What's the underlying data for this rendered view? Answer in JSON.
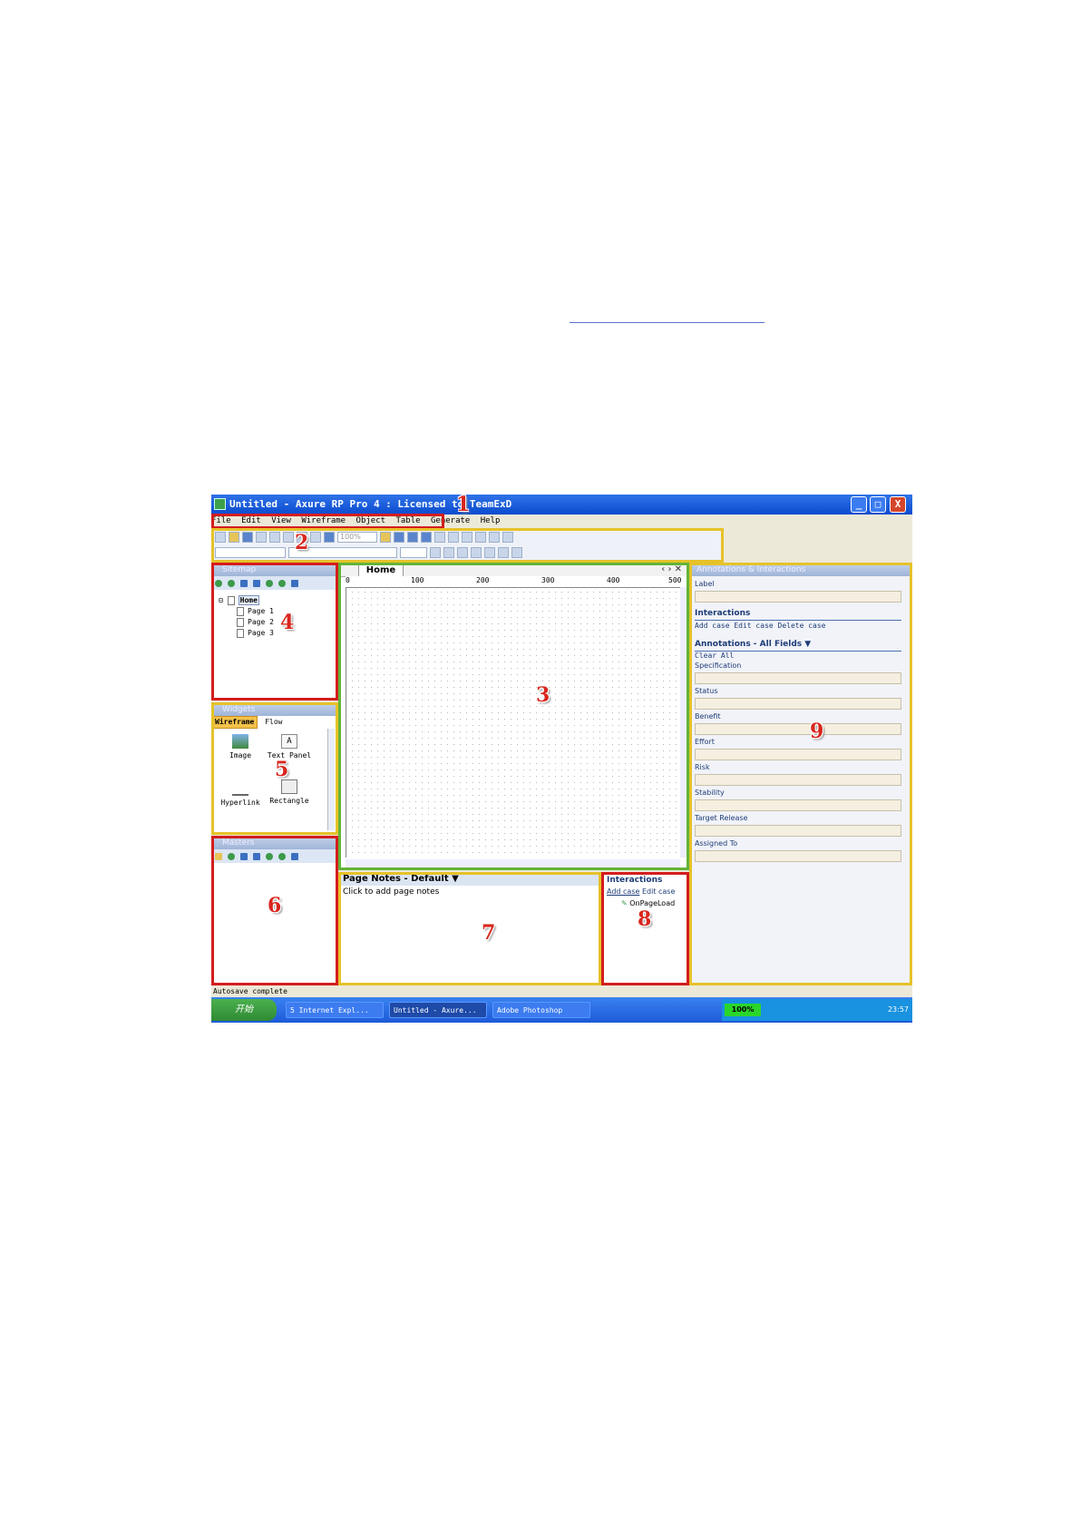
{
  "window": {
    "title": "Untitled - Axure RP Pro 4 : Licensed to TeamExD",
    "buttons": {
      "minimize": "_",
      "maximize": "□",
      "close": "X"
    }
  },
  "menu": [
    "File",
    "Edit",
    "View",
    "Wireframe",
    "Object",
    "Table",
    "Generate",
    "Help"
  ],
  "toolbar": {
    "zoom": "100%"
  },
  "sitemap": {
    "title": "Sitemap",
    "pages": [
      "Home",
      "Page 1",
      "Page 2",
      "Page 3"
    ]
  },
  "widgets": {
    "title": "Widgets",
    "tabs": [
      "Wireframe",
      "Flow"
    ],
    "items": [
      "Image",
      "Text Panel",
      "Hyperlink",
      "Rectangle"
    ]
  },
  "masters": {
    "title": "Masters"
  },
  "canvas": {
    "tab": "Home",
    "ruler": [
      "0",
      "100",
      "200",
      "300",
      "400",
      "500"
    ]
  },
  "page_notes": {
    "title": "Page Notes - Default ▼",
    "placeholder": "Click to add page notes"
  },
  "page_interactions": {
    "title": "Interactions",
    "links": [
      "Add case",
      "Edit case"
    ],
    "event": "OnPageLoad"
  },
  "annotations": {
    "title": "Annotations & Interactions",
    "label": "Label",
    "interactions_title": "Interactions",
    "interactions_links": "Add case  Edit case  Delete case",
    "annotations_title": "Annotations - All Fields ▼",
    "clear": "Clear All",
    "fields": [
      "Specification",
      "Status",
      "Benefit",
      "Effort",
      "Risk",
      "Stability",
      "Target Release",
      "Assigned To"
    ]
  },
  "status": "Autosave complete",
  "taskbar": {
    "start": "开始",
    "tasks": [
      "5 Internet Expl...",
      "Untitled - Axure...",
      "Adobe Photoshop"
    ],
    "battery": "100%",
    "clock": "23:57"
  },
  "callouts": [
    "1",
    "2",
    "3",
    "4",
    "5",
    "6",
    "7",
    "8",
    "9"
  ],
  "colors": {
    "red_box": "#d41d1d",
    "yellow_box": "#e6c22a",
    "green_box": "#63b438",
    "titlebar": "#0b4bcf"
  }
}
